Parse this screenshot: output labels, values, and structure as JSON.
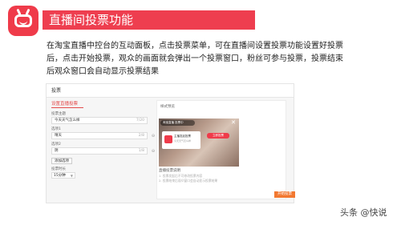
{
  "title": "直播间投票功能",
  "description": "在淘宝直播中控台的互动面板，点击投票菜单，可在直播间设置投票功能设置好投票后，点击开始投票，观众的画面就会弹出一个投票窗口，粉丝可参与投票，投票结束后观众窗口会自动显示投票结果",
  "panel": {
    "header": "投票",
    "tab": "设置直播投票",
    "form": {
      "topic_label": "投票主题",
      "topic_value": "今天天气怎么样",
      "topic_count": "7/20",
      "options_label": "选项1",
      "option1_value": "晴天",
      "option1_count": "2/8",
      "option2_label": "选项2",
      "option2_value": "阴",
      "option2_count": "1/8",
      "add_button": "添加选项",
      "duration_label": "投票时长",
      "duration_value": "15分钟"
    },
    "preview": {
      "label": "样式预览",
      "stream_header": "淘宝直播 投票中",
      "popup_title": "主播发起投票",
      "popup_sub": "今天天气怎么样",
      "vote_button": "立即投票"
    },
    "tips": {
      "heading": "直播投票说明",
      "item1": "1. 投票发起后不可修改投票内容",
      "item2": "2. 投票结束后观众窗口会自动显示投票结果"
    },
    "confirm_button": "开始投票"
  },
  "watermark": "头条 @快说",
  "colors": {
    "accent": "#ee3e4f",
    "confirm": "#f27830"
  }
}
